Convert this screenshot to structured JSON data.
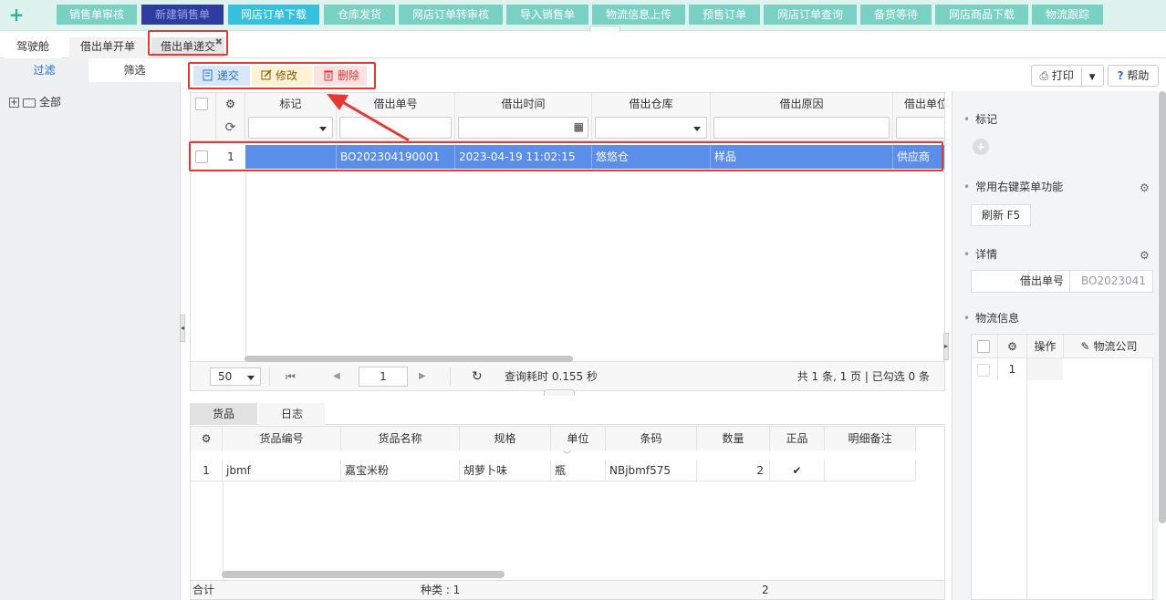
{
  "topbar": {
    "buttons": [
      "销售单审核",
      "新建销售单",
      "网店订单下载",
      "仓库发货",
      "网店订单转审核",
      "导入销售单",
      "物流信息上传",
      "预售订单",
      "网店订单查询",
      "备货等待",
      "网店商品下载",
      "物流跟踪"
    ]
  },
  "tabs": [
    "驾驶舱",
    "借出单开单",
    "借出单递交"
  ],
  "left": {
    "tab_filter": "过滤",
    "tab_select": "筛选",
    "tree_root": "全部"
  },
  "actions": {
    "submit": "递交",
    "edit": "修改",
    "delete": "删除",
    "print": "打印",
    "help": "帮助"
  },
  "grid": {
    "headers": [
      "标记",
      "借出单号",
      "借出时间",
      "借出仓库",
      "借出原因",
      "借出单位"
    ],
    "row": {
      "index": "1",
      "order_no": "BO202304190001",
      "time": "2023-04-19 11:02:15",
      "warehouse": "悠悠仓",
      "reason": "样品",
      "unit": "供应商"
    }
  },
  "pager": {
    "page_size": "50",
    "page": "1",
    "query_time": "查询耗时 0.155 秒",
    "summary": "共 1 条, 1 页 | 已勾选 0 条"
  },
  "lower": {
    "tab_goods": "货品",
    "tab_log": "日志",
    "headers": [
      "货品编号",
      "货品名称",
      "规格",
      "单位",
      "条码",
      "数量",
      "正品",
      "明细备注"
    ],
    "row": {
      "index": "1",
      "code": "jbmf",
      "name": "嘉宝米粉",
      "spec": "胡萝卜味",
      "unit": "瓶",
      "barcode": "NBjbmf575",
      "qty": "2",
      "genuine": "✔",
      "remark": ""
    },
    "footer_total": "合计",
    "footer_kinds": "种类 : 1",
    "footer_qty": "2"
  },
  "right": {
    "mark_title": "标记",
    "menu_title": "常用右键菜单功能",
    "refresh_btn": "刷新  F5",
    "detail_title": "详情",
    "detail_key": "借出单号",
    "detail_val": "BO2023041",
    "logistics_title": "物流信息",
    "logistics_op": "操作",
    "logistics_company": "物流公司",
    "logistics_row": "1"
  },
  "colors": {
    "accent": "#5a8ee8",
    "topbtn": "#78d1c2",
    "highlight": "#e53935"
  }
}
